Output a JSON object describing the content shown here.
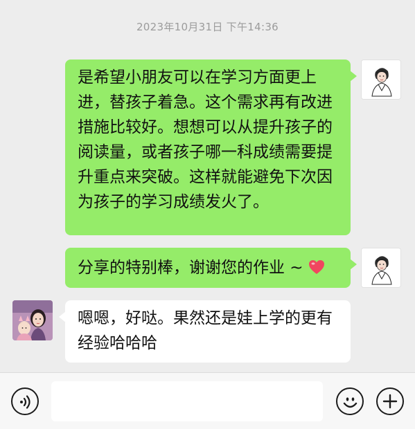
{
  "chat": {
    "timestamp": "2023年10月31日 下午14:36",
    "messages": [
      {
        "direction": "outgoing",
        "text": "是希望小朋友可以在学习方面更上进，替孩子着急。这个需求再有改进措施比较好。想想可以从提升孩子的阅读量，或者孩子哪一科成绩需要提升重点来突破。这样就能避免下次因为孩子的学习成绩发火了。"
      },
      {
        "direction": "outgoing",
        "text": "分享的特别棒，谢谢您的作业 ~",
        "emoji": "heart-icon"
      },
      {
        "direction": "incoming",
        "text": "嗯嗯，好哒。果然还是娃上学的更有经验哈哈哈"
      }
    ]
  },
  "input_bar": {
    "voice_icon": "voice-icon",
    "input_value": "",
    "emoji_icon": "smiley-icon",
    "plus_icon": "plus-icon"
  },
  "colors": {
    "background": "#ededed",
    "outgoing_bubble": "#95ec69",
    "incoming_bubble": "#ffffff",
    "heart": "#f0465f"
  }
}
